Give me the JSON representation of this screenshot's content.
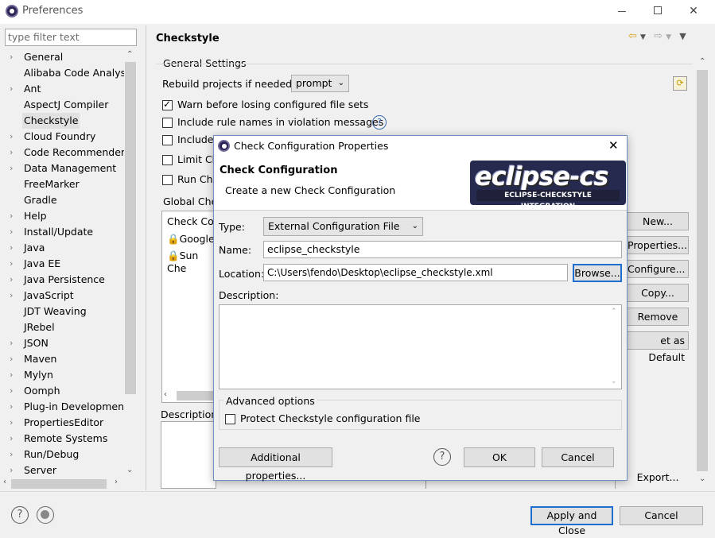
{
  "window": {
    "title": "Preferences"
  },
  "filter": {
    "placeholder": "type filter text"
  },
  "tree": [
    {
      "label": "General",
      "expandable": true
    },
    {
      "label": "Alibaba Code Analysis",
      "expandable": false
    },
    {
      "label": "Ant",
      "expandable": true
    },
    {
      "label": "AspectJ Compiler",
      "expandable": false
    },
    {
      "label": "Checkstyle",
      "expandable": false,
      "selected": true
    },
    {
      "label": "Cloud Foundry",
      "expandable": true
    },
    {
      "label": "Code Recommenders",
      "expandable": true
    },
    {
      "label": "Data Management",
      "expandable": true
    },
    {
      "label": "FreeMarker",
      "expandable": false
    },
    {
      "label": "Gradle",
      "expandable": false
    },
    {
      "label": "Help",
      "expandable": true
    },
    {
      "label": "Install/Update",
      "expandable": true
    },
    {
      "label": "Java",
      "expandable": true
    },
    {
      "label": "Java EE",
      "expandable": true
    },
    {
      "label": "Java Persistence",
      "expandable": true
    },
    {
      "label": "JavaScript",
      "expandable": true
    },
    {
      "label": "JDT Weaving",
      "expandable": false
    },
    {
      "label": "JRebel",
      "expandable": false
    },
    {
      "label": "JSON",
      "expandable": true
    },
    {
      "label": "Maven",
      "expandable": true
    },
    {
      "label": "Mylyn",
      "expandable": true
    },
    {
      "label": "Oomph",
      "expandable": true
    },
    {
      "label": "Plug-in Development",
      "expandable": true
    },
    {
      "label": "PropertiesEditor",
      "expandable": true
    },
    {
      "label": "Remote Systems",
      "expandable": true
    },
    {
      "label": "Run/Debug",
      "expandable": true
    },
    {
      "label": "Server",
      "expandable": true
    }
  ],
  "page": {
    "title": "Checkstyle",
    "general_settings": "General Settings",
    "rebuild_label": "Rebuild projects if needed:",
    "rebuild_value": "prompt",
    "warn_label": "Warn before losing configured file sets",
    "include_rule_label": "Include rule names in violation messages",
    "include_label_partial": "Include",
    "limit_label_partial": "Limit Ch",
    "run_label_partial": "Run Ch",
    "global_label_partial": "Global Che",
    "check_col_partial": "Check Co",
    "configs": [
      "Google",
      "Sun Che"
    ],
    "description_label_partial": "Description",
    "buttons": {
      "new": "New...",
      "properties": "Properties...",
      "configure": "Configure...",
      "copy": "Copy...",
      "remove": "Remove",
      "set_default_partial": "et as Default",
      "export": "Export..."
    }
  },
  "dialog": {
    "title": "Check Configuration Properties",
    "heading": "Check Configuration",
    "subheading": "Create a new Check Configuration",
    "logo_text": "eclipse-cs",
    "logo_subtext": "ECLIPSE-CHECKSTYLE INTEGRATION",
    "type_label": "Type:",
    "type_value": "External Configuration File",
    "name_label": "Name:",
    "name_value": "eclipse_checkstyle",
    "location_label": "Location:",
    "location_value": "C:\\Users\\fendo\\Desktop\\eclipse_checkstyle.xml",
    "browse_button": "Browse...",
    "description_label": "Description:",
    "description_value": "",
    "advanced_label": "Advanced options",
    "protect_label": "Protect Checkstyle configuration file",
    "additional_button": "Additional properties...",
    "ok_button": "OK",
    "cancel_button": "Cancel"
  },
  "footer": {
    "apply_close": "Apply and Close",
    "cancel": "Cancel"
  },
  "colors": {
    "focus_border": "#1f6fd0",
    "help_blue": "#3a6fb0",
    "logo_bg": "#262a4e"
  }
}
